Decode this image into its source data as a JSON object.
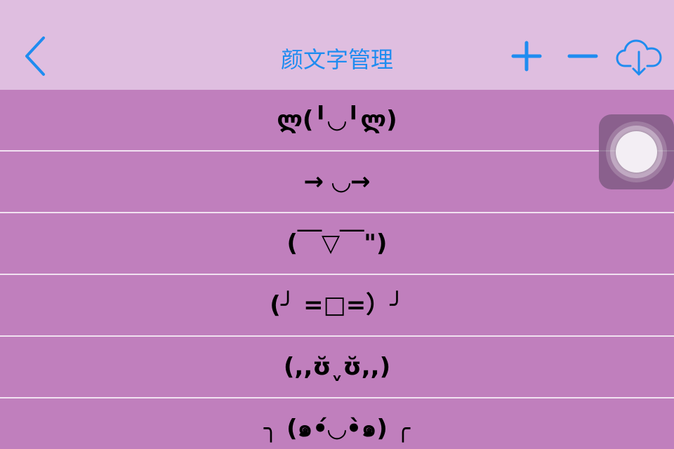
{
  "navbar": {
    "title": "颜文字管理",
    "back_icon": "chevron-left-icon",
    "add_icon": "plus-icon",
    "remove_icon": "minus-icon",
    "cloud_icon": "cloud-download-icon"
  },
  "emoticons": [
    "ლ(╹◡╹ლ)",
    "→ ◡→",
    "(￣▽￣\")",
    "(╯ =□=）╯",
    "(,,ʊ̆ˬʊ̆,,)",
    "╮ (๑•́◡•̀๑) ╭"
  ],
  "assistive_touch": {
    "icon": "assistive-touch-icon"
  },
  "colors": {
    "navbar_bg": "#dfbee0",
    "list_bg": "#c07fbd",
    "accent": "#1f8cf0",
    "separator": "#f1e2f1"
  }
}
